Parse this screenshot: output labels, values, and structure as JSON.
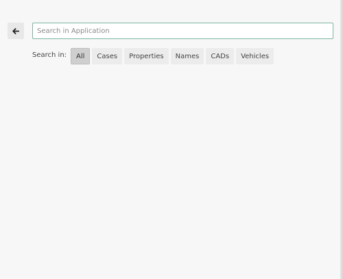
{
  "search": {
    "placeholder": "Search in Application",
    "value": ""
  },
  "back_button": {
    "icon": "arrow-left-icon"
  },
  "filters": {
    "label": "Search in:",
    "selected": "All",
    "options": [
      "All",
      "Cases",
      "Properties",
      "Names",
      "CADs",
      "Vehicles"
    ]
  }
}
